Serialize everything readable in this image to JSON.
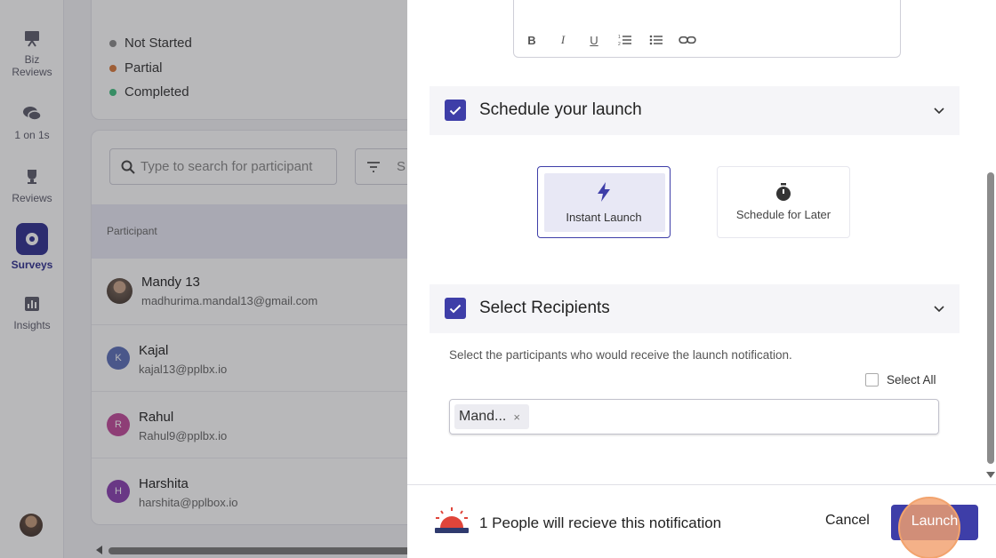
{
  "nav": {
    "items": [
      {
        "label": "Biz\nReviews",
        "icon": "presentation-icon"
      },
      {
        "label": "1 on 1s",
        "icon": "chat-bubbles-icon"
      },
      {
        "label": "Reviews",
        "icon": "trophy-icon"
      },
      {
        "label": "Surveys",
        "icon": "survey-icon",
        "active": true
      },
      {
        "label": "Insights",
        "icon": "bar-chart-icon"
      }
    ]
  },
  "status_legend": [
    {
      "label": "Not Started",
      "color": "#8a8a8a"
    },
    {
      "label": "Partial",
      "color": "#d9793b"
    },
    {
      "label": "Completed",
      "color": "#3fbf7f"
    }
  ],
  "participants_table": {
    "search_placeholder": "Type to search for participant",
    "filter_text": "S",
    "column_header": "Participant",
    "rows": [
      {
        "name": "Mandy 13",
        "email": "madhurima.mandal13@gmail.com",
        "initial": "",
        "color": "#6b5a4e",
        "photo": true
      },
      {
        "name": "Kajal",
        "email": "kajal13@pplbx.io",
        "initial": "K",
        "color": "#5b6fb8"
      },
      {
        "name": "Rahul",
        "email": "Rahul9@pplbx.io",
        "initial": "R",
        "color": "#c04a9a"
      },
      {
        "name": "Harshita",
        "email": "harshita@pplbox.io",
        "initial": "H",
        "color": "#8a3fb0"
      }
    ]
  },
  "panel": {
    "schedule_title": "Schedule your launch",
    "options": {
      "instant": "Instant Launch",
      "later": "Schedule for Later"
    },
    "recipients_title": "Select Recipients",
    "recipients_description": "Select the participants who would receive the launch notification.",
    "select_all_label": "Select All",
    "selected_chip": "Mand...",
    "chip_remove": "×"
  },
  "footer": {
    "notification_text": "1 People will recieve this notification",
    "cancel_label": "Cancel",
    "launch_label": "Launch"
  },
  "colors": {
    "accent": "#3e3ea8",
    "overlay": "rgba(40,40,45,0.33)"
  }
}
